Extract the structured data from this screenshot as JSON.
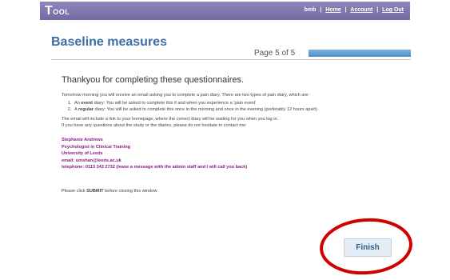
{
  "header": {
    "logo_big": "T",
    "logo_rest": "OOL",
    "username": "bmb",
    "nav": [
      "Home",
      "Account",
      "Log Out"
    ]
  },
  "page": {
    "title": "Baseline measures",
    "progress_label": "Page 5 of 5",
    "progress_fraction": 1.0
  },
  "content": {
    "heading": "Thankyou for completing these questionnaires.",
    "intro": "Tomorrow morning you will receive an email asking you to complete a pain diary. There are two types of pain diary, which are:",
    "diaries": [
      {
        "bold": "event",
        "prefix": "An ",
        "text": " diary: You will be asked to complete this if and when you experience a 'pain event'"
      },
      {
        "bold": "regular",
        "prefix": "A ",
        "text": " diary: You will be asked to complete this once in the morning and once in the evening (preferably 12 hours apart)"
      }
    ],
    "email_note": "The email will include a link to your homepage, where the correct diary will be waiting for you when you log in.",
    "questions": "If you have any questions about the study or the diaries, please do not hesitate to contact me:",
    "contact": [
      "Stephanie Andrews",
      "Psychologist in Clinical Training",
      "University of Leeds",
      "email: umshan@leeds.ac.uk",
      "telephone: 0113 343 2732 (leave a message with the admin staff and I will call you back)"
    ],
    "submit_prefix": "Please click ",
    "submit_bold": "SUBMIT",
    "submit_suffix": " before closing this window."
  },
  "finish_label": "Finish",
  "colors": {
    "header_bg": "#7b73aa",
    "title": "#3b6ea5",
    "contact": "#8b1a8b",
    "annotation": "#d00000"
  }
}
